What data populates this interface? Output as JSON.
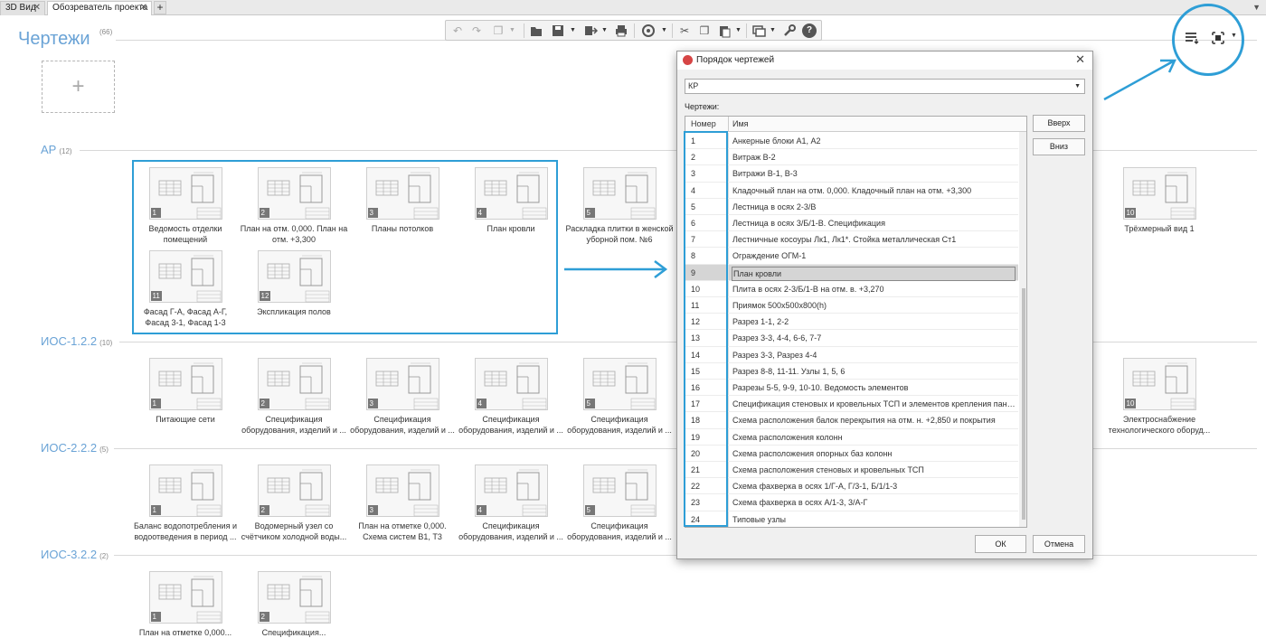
{
  "tabs": [
    {
      "label": "3D Вид",
      "active": false
    },
    {
      "label": "Обозреватель проекта",
      "active": true
    }
  ],
  "page": {
    "title": "Чертежи",
    "count": "(66)"
  },
  "accent_color": "#2e9ed6",
  "title_color": "#6aa3d6",
  "toolbar": [
    "undo-icon",
    "redo-icon",
    "copy-sheets-icon",
    "folder-icon",
    "save-icon",
    "export-icon",
    "print-icon",
    "publish-icon",
    "cut-icon",
    "copy-icon",
    "paste-icon",
    "layers-icon",
    "wrench-icon",
    "help-icon"
  ],
  "help_label": "?",
  "add_tile": "+",
  "groups": [
    {
      "title": "АР",
      "count": "(12)"
    },
    {
      "title": "ИОС-1.2.2",
      "count": "(10)"
    },
    {
      "title": "ИОС-2.2.2",
      "count": "(5)"
    },
    {
      "title": "ИОС-3.2.2",
      "count": "(2)"
    }
  ],
  "ar_cards": [
    {
      "num": "1",
      "caption": "Ведомость отделки помещений"
    },
    {
      "num": "2",
      "caption": "План на отм. 0,000. План на отм. +3,300"
    },
    {
      "num": "3",
      "caption": "Планы потолков"
    },
    {
      "num": "4",
      "caption": "План кровли"
    },
    {
      "num": "5",
      "caption": "Раскладка плитки в женской уборной пом. №6"
    },
    {
      "num": "10",
      "caption": "Трёхмерный вид 1"
    },
    {
      "num": "11",
      "caption": "Фасад Г-А, Фасад А-Г, Фасад 3-1, Фасад 1-3"
    },
    {
      "num": "12",
      "caption": "Экспликация полов"
    }
  ],
  "ios1_cards": [
    {
      "num": "1",
      "caption": "Питающие сети"
    },
    {
      "num": "2",
      "caption": "Спецификация оборудования, изделий и ..."
    },
    {
      "num": "3",
      "caption": "Спецификация оборудования, изделий и ..."
    },
    {
      "num": "4",
      "caption": "Спецификация оборудования, изделий и ..."
    },
    {
      "num": "5",
      "caption": "Спецификация оборудования, изделий и ..."
    },
    {
      "num": "10",
      "caption": "Электроснабжение технологического оборуд..."
    }
  ],
  "ios2_cards": [
    {
      "num": "1",
      "caption": "Баланс водопотребления и водоотведения в период ..."
    },
    {
      "num": "2",
      "caption": "Водомерный узел со счётчиком холодной воды..."
    },
    {
      "num": "3",
      "caption": "План на отметке 0,000. Схема систем В1, Т3"
    },
    {
      "num": "4",
      "caption": "Спецификация оборудования, изделий и ..."
    },
    {
      "num": "5",
      "caption": "Спецификация оборудования, изделий и ..."
    }
  ],
  "ios3_cards": [
    {
      "num": "1",
      "caption": "План на отметке 0,000..."
    },
    {
      "num": "2",
      "caption": "Спецификация..."
    }
  ],
  "dialog": {
    "title": "Порядок чертежей",
    "close": "✕",
    "select_value": "КР",
    "list_label": "Чертежи:",
    "col_num": "Номер",
    "col_name": "Имя",
    "up_button": "Вверх",
    "down_button": "Вниз",
    "ok_button": "ОК",
    "cancel_button": "Отмена",
    "selected_index": 8,
    "rows": [
      {
        "n": "1",
        "name": "Анкерные блоки А1, А2"
      },
      {
        "n": "2",
        "name": "Витраж В-2"
      },
      {
        "n": "3",
        "name": "Витражи В-1, В-3"
      },
      {
        "n": "4",
        "name": "Кладочный план на отм. 0,000. Кладочный план на отм. +3,300"
      },
      {
        "n": "5",
        "name": "Лестница в осях 2-3/В"
      },
      {
        "n": "6",
        "name": "Лестница в осях 3/Б/1-В. Спецификация"
      },
      {
        "n": "7",
        "name": "Лестничные косоуры Лк1, Лк1*. Стойка металлическая Ст1"
      },
      {
        "n": "8",
        "name": "Ограждение ОГМ-1"
      },
      {
        "n": "9",
        "name": "План кровли"
      },
      {
        "n": "10",
        "name": "Плита в осях 2-3/Б/1-В на отм. в. +3,270"
      },
      {
        "n": "11",
        "name": "Приямок 500х500х800(h)"
      },
      {
        "n": "12",
        "name": "Разрез 1-1, 2-2"
      },
      {
        "n": "13",
        "name": "Разрез 3-3, 4-4, 6-6, 7-7"
      },
      {
        "n": "14",
        "name": "Разрез 3-3, Разрез 4-4"
      },
      {
        "n": "15",
        "name": "Разрез 8-8, 11-11. Узлы 1, 5, 6"
      },
      {
        "n": "16",
        "name": "Разрезы 5-5, 9-9, 10-10. Ведомость элементов"
      },
      {
        "n": "17",
        "name": "Спецификация стеновых и кровельных ТСП и элементов крепления панел..."
      },
      {
        "n": "18",
        "name": "Схема расположения балок перекрытия на отм. н. +2,850 и покрытия"
      },
      {
        "n": "19",
        "name": "Схема расположения колонн"
      },
      {
        "n": "20",
        "name": "Схема расположения опорных баз колонн"
      },
      {
        "n": "21",
        "name": "Схема расположения стеновых и кровельных ТСП"
      },
      {
        "n": "22",
        "name": "Схема фахверка в осях 1/Г-А, Г/3-1, Б/1/1-3"
      },
      {
        "n": "23",
        "name": "Схема фахверка в осях А/1-3, 3/А-Г"
      },
      {
        "n": "24",
        "name": "Типовые узлы"
      }
    ]
  }
}
